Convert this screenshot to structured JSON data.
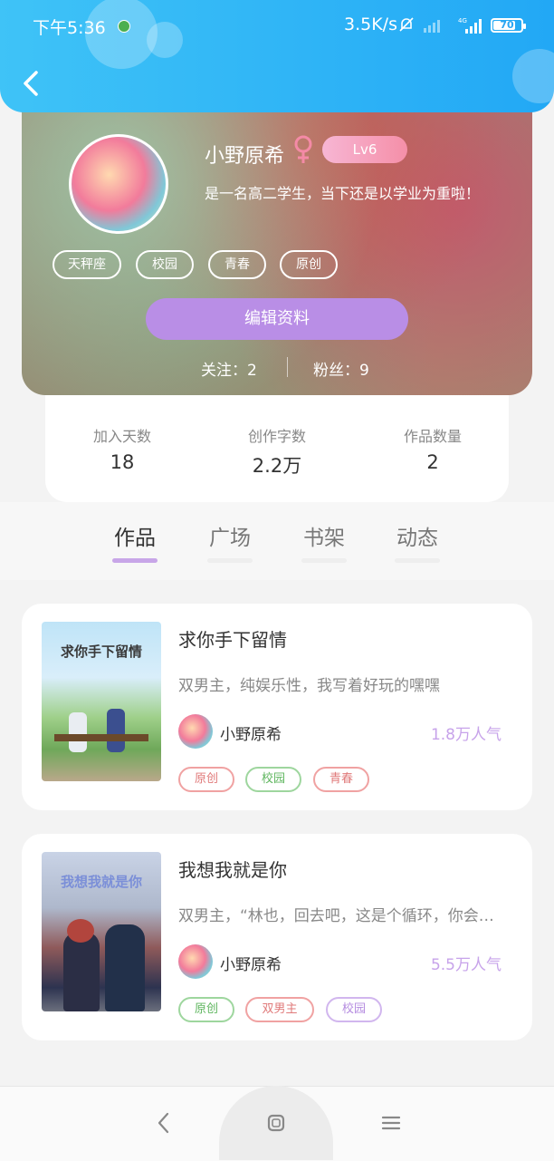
{
  "status_bar": {
    "time": "下午5:36",
    "network_speed": "3.5K/s",
    "signal_label": "4G",
    "battery": "70"
  },
  "profile": {
    "username": "小野原希",
    "level": "Lv6",
    "bio": "是一名高二学生，当下还是以学业为重啦！",
    "tags": [
      "天秤座",
      "校园",
      "青春",
      "原创"
    ],
    "edit_label": "编辑资料",
    "following_label": "关注：2",
    "followers_label": "粉丝：9"
  },
  "stats": [
    {
      "label": "加入天数",
      "value": "18"
    },
    {
      "label": "创作字数",
      "value": "2.2万"
    },
    {
      "label": "作品数量",
      "value": "2"
    }
  ],
  "tabs": [
    "作品",
    "广场",
    "书架",
    "动态"
  ],
  "active_tab": "作品",
  "works": [
    {
      "title": "求你手下留情",
      "cover_text": "求你手下留情",
      "desc": "双男主，纯娱乐性，我写着好玩的嘿嘿",
      "author": "小野原希",
      "popularity": "1.8万人气",
      "tags": [
        "原创",
        "校园",
        "青春"
      ]
    },
    {
      "title": "我想我就是你",
      "cover_text": "我想我就是你",
      "desc": "双男主，“林也，回去吧，这是个循环，你会…",
      "author": "小野原希",
      "popularity": "5.5万人气",
      "tags": [
        "原创",
        "双男主",
        "校园"
      ]
    }
  ],
  "colors": {
    "header": "#22a8f5",
    "accent": "#b98ee6",
    "popularity": "#c7a3ea"
  }
}
